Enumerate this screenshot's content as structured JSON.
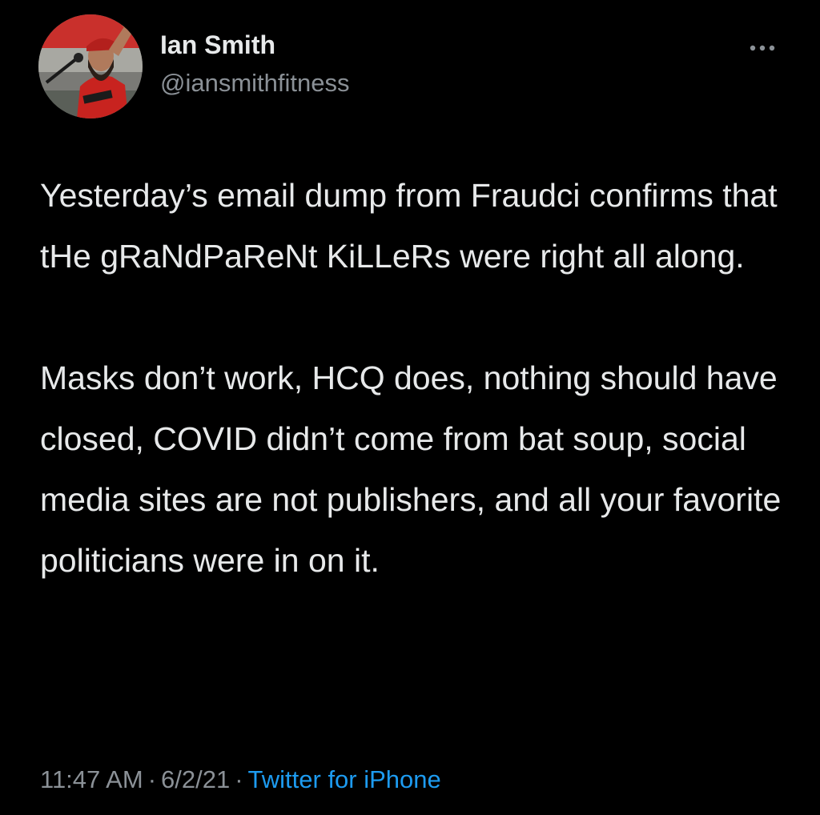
{
  "tweet": {
    "author": {
      "name": "Ian Smith",
      "handle": "@iansmithfitness"
    },
    "body": {
      "paragraph_1": "Yesterday’s email dump from Fraudci confirms that tHe gRaNdPaReNt KiLLeRs were right all along.",
      "paragraph_2": "Masks don’t work, HCQ does, nothing should have closed, COVID didn’t come from bat soup, social media sites are not publishers, and all your favorite politicians were in on it."
    },
    "meta": {
      "time": "11:47 AM",
      "separator": "·",
      "date": "6/2/21",
      "source": "Twitter for iPhone"
    },
    "icons": {
      "more": "more-horizontal-icon",
      "avatar": "profile-avatar"
    },
    "colors": {
      "background": "#000000",
      "text": "#e7e9ea",
      "secondary": "#8b9197",
      "link": "#1d9bf0"
    }
  }
}
